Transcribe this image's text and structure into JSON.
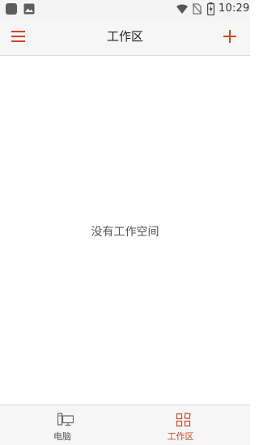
{
  "status_bar": {
    "time": "10:29",
    "left_icons": [
      "app-square-icon",
      "image-icon"
    ],
    "right_icons": [
      "wifi-icon",
      "no-sim-icon",
      "battery-charging-icon"
    ]
  },
  "app_bar": {
    "title": "工作区",
    "menu_icon": "hamburger-menu-icon",
    "add_icon": "plus-icon"
  },
  "main": {
    "empty_message": "没有工作空间"
  },
  "bottom_nav": {
    "items": [
      {
        "label": "电脑",
        "icon": "computer-icon",
        "active": false
      },
      {
        "label": "工作区",
        "icon": "workspace-grid-icon",
        "active": true
      }
    ]
  },
  "colors": {
    "accent": "#d04424",
    "bar_background": "#f6f6f6",
    "text_primary": "#222222",
    "text_secondary": "#555555"
  }
}
